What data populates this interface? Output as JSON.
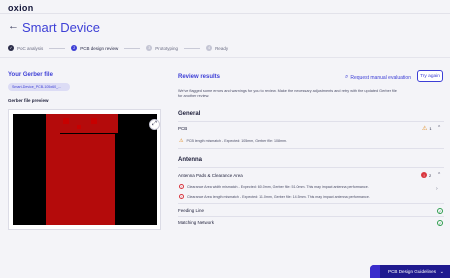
{
  "app": {
    "logo": "oxion",
    "back_icon": "arrow-left-icon",
    "title": "Smart Device"
  },
  "steps": [
    {
      "label": "PoC analysis",
      "state": "done",
      "marker": "✓"
    },
    {
      "label": "PCB design review",
      "state": "active",
      "marker": "2"
    },
    {
      "label": "Prototyping",
      "state": "todo",
      "marker": "3"
    },
    {
      "label": "Ready",
      "state": "todo",
      "marker": "4"
    }
  ],
  "left": {
    "title": "Your Gerber file",
    "file_chip": "Smart-Device_PCB-105x60_...",
    "preview_label": "Gerber file preview",
    "expand_icon": "expand-icon"
  },
  "right": {
    "title": "Review results",
    "manual_label": "Request manual evaluation",
    "try_again_label": "Try again",
    "description": "We've flagged some errors and warnings for you to review. Make the necessary adjustments and retry with the updated Gerber file for another review."
  },
  "general": {
    "heading": "General",
    "pcb": {
      "label": "PCB",
      "warn_count": "1",
      "message": "PCB length mismatch - Expected: 105mm, Gerber file: 108mm."
    }
  },
  "antenna": {
    "heading": "Antenna",
    "pads": {
      "label": "Antenna Pads & Clearance Area",
      "err_count": "2",
      "messages": [
        "Clearance Area width mismatch - Expected: 60.0mm, Gerber file: 51.0mm. This may impact antenna performance.",
        "Clearance Area length mismatch - Expected: 11.0mm, Gerber file: 14.5mm. This may impact antenna performance."
      ]
    },
    "feeding_line": {
      "label": "Feeding Line"
    },
    "matching_network": {
      "label": "Matching Network"
    }
  },
  "guide": {
    "label": "PCB Design Guidelines"
  },
  "colors": {
    "accent": "#3d3fd6",
    "warning": "#e08a1e",
    "error": "#d9363e",
    "success": "#2f9e4f",
    "guide_bg": "#1f1a8f"
  }
}
